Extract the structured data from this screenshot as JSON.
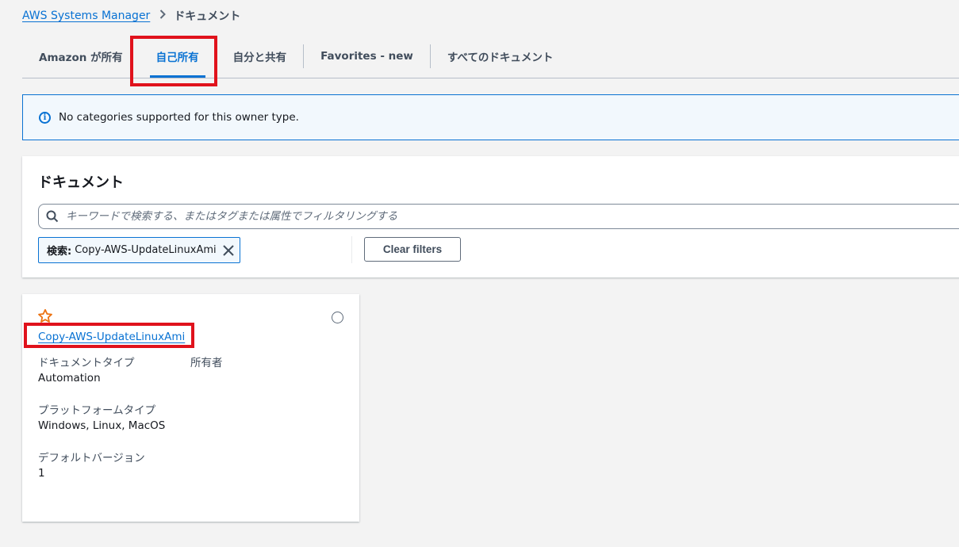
{
  "breadcrumb": {
    "root": "AWS Systems Manager",
    "current": "ドキュメント"
  },
  "tabs": [
    {
      "label": "Amazon が所有",
      "active": false
    },
    {
      "label": "自己所有",
      "active": true
    },
    {
      "label": "自分と共有",
      "active": false
    },
    {
      "label": "Favorites - new",
      "active": false
    },
    {
      "label": "すべてのドキュメント",
      "active": false
    }
  ],
  "info": {
    "message": "No categories supported for this owner type."
  },
  "documents_panel": {
    "title": "ドキュメント",
    "search_placeholder": "キーワードで検索する、またはタグまたは属性でフィルタリングする",
    "token_key": "検索:",
    "token_value": "Copy-AWS-UpdateLinuxAmi",
    "clear_filters": "Clear filters"
  },
  "card": {
    "name": "Copy-AWS-UpdateLinuxAmi",
    "doc_type_label": "ドキュメントタイプ",
    "doc_type_value": "Automation",
    "owner_label": "所有者",
    "platform_label": "プラットフォームタイプ",
    "platform_value": "Windows, Linux, MacOS",
    "version_label": "デフォルトバージョン",
    "version_value": "1"
  },
  "colors": {
    "accent": "#0972d3",
    "annotation": "#e0121c",
    "star": "#ec7211"
  }
}
